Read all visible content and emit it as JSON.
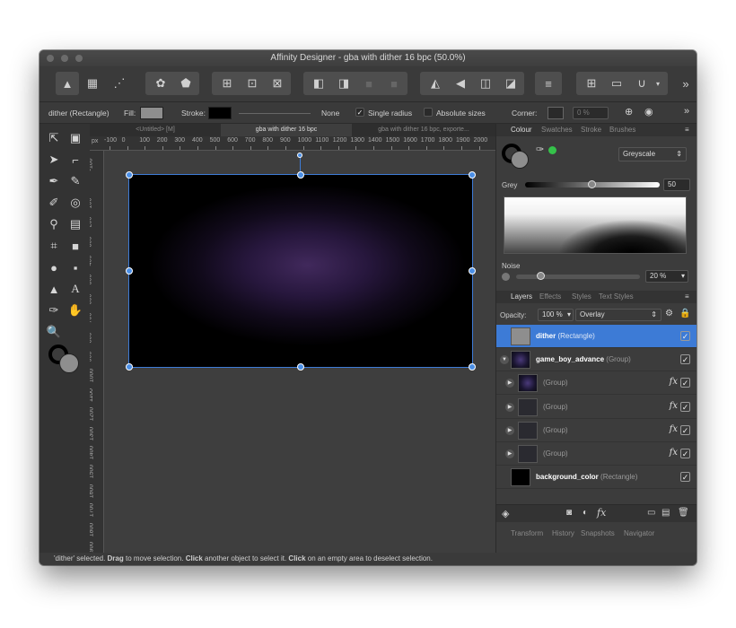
{
  "window": {
    "title": "Affinity Designer - gba with dither 16 bpc (50.0%)"
  },
  "context_bar": {
    "selection": "dither (Rectangle)",
    "fill_label": "Fill:",
    "stroke_label": "Stroke:",
    "stroke_value": "None",
    "single_radius": "Single radius",
    "absolute_sizes": "Absolute sizes",
    "corner_label": "Corner:",
    "corner_value": "0 %",
    "fill_color": "#8e8e8e",
    "stroke_color": "#000000",
    "overflow": "»"
  },
  "doc_tabs": [
    "<Untitled> [M]",
    "gba with dither 16 bpc",
    "gba with dither 16 bpc, exporte..."
  ],
  "ruler": {
    "unit": "px",
    "h_ticks": [
      "-100",
      "0",
      "100",
      "200",
      "300",
      "400",
      "500",
      "600",
      "700",
      "800",
      "900",
      "1000",
      "1100",
      "1200",
      "1300",
      "1400",
      "1500",
      "1600",
      "1700",
      "1800",
      "1900",
      "2000"
    ],
    "v_ticks": [
      "-100",
      "0",
      "100",
      "200",
      "300",
      "400",
      "500",
      "600",
      "700",
      "800",
      "900",
      "1000",
      "1100",
      "1200",
      "1300",
      "1400",
      "1500",
      "1600",
      "1700",
      "1800",
      "1900",
      "2000"
    ]
  },
  "colour_panel": {
    "tabs": [
      "Colour",
      "Swatches",
      "Stroke",
      "Brushes"
    ],
    "mode": "Greyscale",
    "grey_label": "Grey",
    "grey_value": "50",
    "grey_level": 0.5,
    "noise_label": "Noise",
    "noise_value": "20 %",
    "noise_level": 0.2
  },
  "layers_panel": {
    "tabs": [
      "Layers",
      "Effects",
      "Styles",
      "Text Styles"
    ],
    "opacity_label": "Opacity:",
    "opacity_value": "100 %",
    "blend_mode": "Overlay",
    "layers": [
      {
        "name": "dither",
        "type": "(Rectangle)"
      },
      {
        "name": "game_boy_advance",
        "type": "(Group)"
      },
      {
        "name": "",
        "type": "(Group)",
        "fx": "fx"
      },
      {
        "name": "",
        "type": "(Group)",
        "fx": "fx"
      },
      {
        "name": "",
        "type": "(Group)",
        "fx": "fx"
      },
      {
        "name": "",
        "type": "(Group)",
        "fx": "fx"
      },
      {
        "name": "background_color",
        "type": "(Rectangle)"
      }
    ]
  },
  "bottom_tabs": [
    "Transform",
    "History",
    "Snapshots",
    "Navigator"
  ],
  "status": {
    "p1": "'dither' selected. ",
    "b1": "Drag",
    "p2": " to move selection. ",
    "b2": "Click",
    "p3": " another object to select it. ",
    "b3": "Click",
    "p4": " on an empty area to deselect selection."
  },
  "colors": {
    "selection": "#3d7bd6",
    "accent_green": "#35c24a"
  }
}
